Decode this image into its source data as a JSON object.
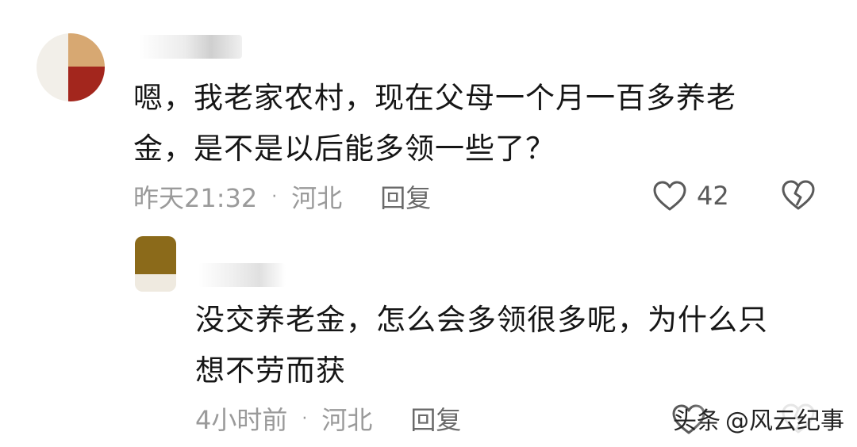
{
  "comments": [
    {
      "text_line1": "嗯，我老家农村，现在父母一个月一百多养老",
      "text_line2": "金，是不是以后能多领一些了？",
      "time": "昨天21:32",
      "separator": "·",
      "location": "河北",
      "reply_label": "回复",
      "likes": "42",
      "icons": [
        "heart-icon",
        "broken-heart-icon"
      ]
    },
    {
      "text_line1": "没交养老金，怎么会多领很多呢，为什么只",
      "text_line2": "想不劳而获",
      "time": "4小时前",
      "separator": "·",
      "location": "河北",
      "reply_label": "回复",
      "icons": [
        "heart-icon",
        "broken-heart-icon"
      ]
    }
  ],
  "watermark": {
    "brand": "头条",
    "handle": "@风云纪事"
  },
  "colors": {
    "text": "#161616",
    "meta": "#9a9a9a",
    "icon": "#5a5a5a"
  }
}
